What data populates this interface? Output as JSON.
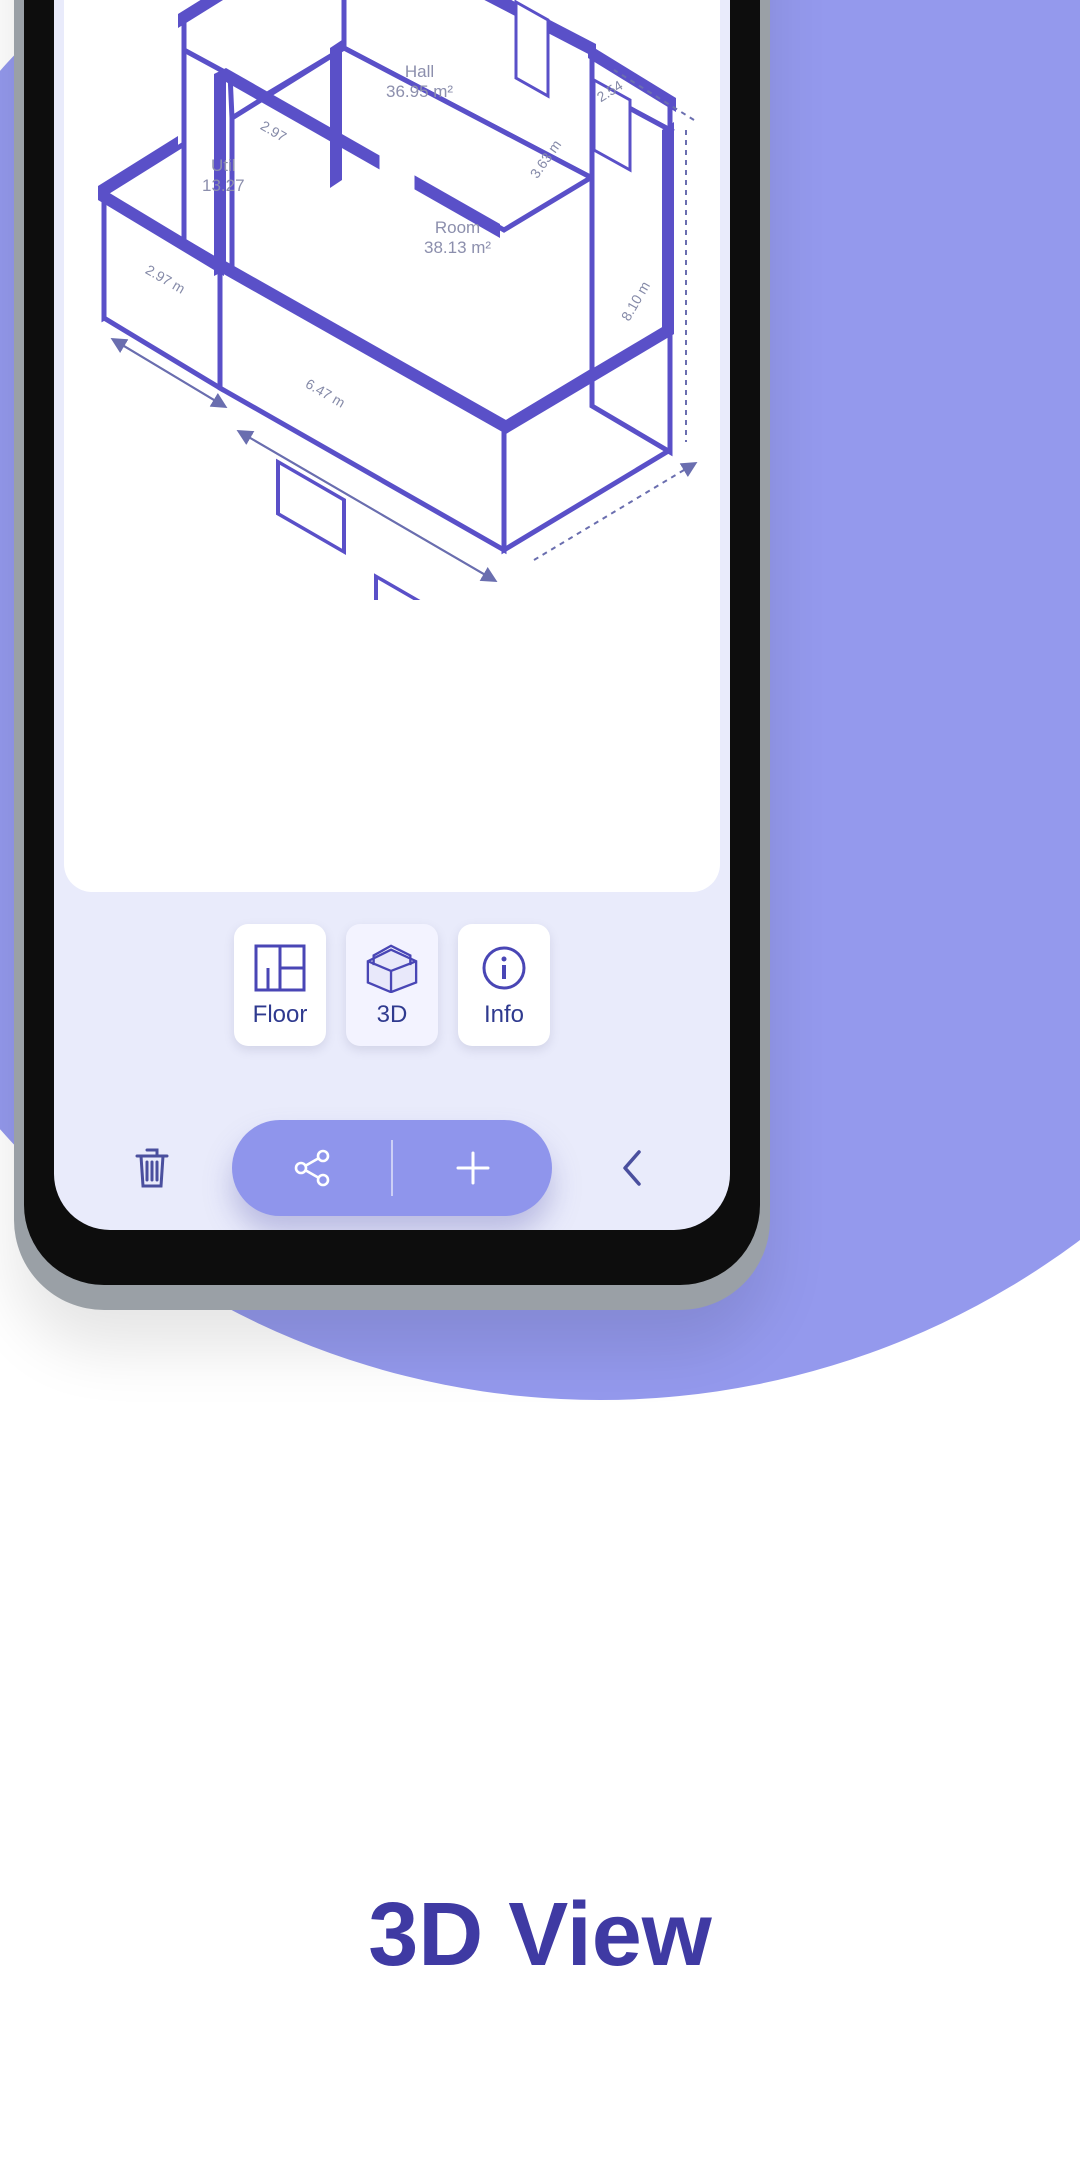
{
  "caption": "3D View",
  "view_buttons": {
    "floor": {
      "label": "Floor"
    },
    "three_d": {
      "label": "3D"
    },
    "info": {
      "label": "Info"
    }
  },
  "floorplan": {
    "rooms": {
      "hall": {
        "name": "Hall",
        "area": "36.95 m²"
      },
      "util": {
        "name": "Util",
        "area": "13.27"
      },
      "room": {
        "name": "Room",
        "area": "38.13 m²"
      }
    },
    "dimensions": {
      "d1": "2.97 m",
      "d2": "2.97",
      "d3": "6.47 m",
      "d4": "3.63 m",
      "d5": "8.10 m",
      "d6": "2.54"
    }
  },
  "colors": {
    "accent": "#5a50c8",
    "lavender": "#9499ed"
  }
}
